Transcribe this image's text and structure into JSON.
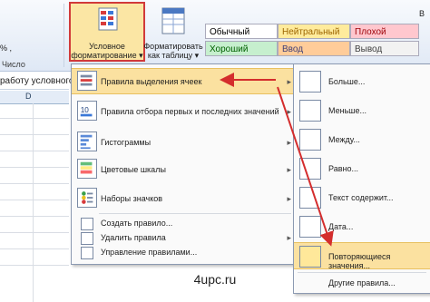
{
  "ribbon": {
    "left_partial": "%   ,",
    "group_label": "Число",
    "conditional_formatting": "Условное форматирование ▾",
    "format_as_table": "Форматировать как таблицу ▾",
    "right_partial": "В"
  },
  "cell_styles": [
    {
      "label": "Обычный",
      "bg": "#ffffff",
      "color": "#000000"
    },
    {
      "label": "Нейтральный",
      "bg": "#ffeb9c",
      "color": "#9c6500"
    },
    {
      "label": "Плохой",
      "bg": "#ffc7ce",
      "color": "#9c0006"
    },
    {
      "label": "Хороший",
      "bg": "#c6efce",
      "color": "#006100"
    },
    {
      "label": "Ввод",
      "bg": "#ffcc99",
      "color": "#3f3f76"
    },
    {
      "label": "Вывод",
      "bg": "#f2f2f2",
      "color": "#3f3f3f"
    }
  ],
  "formula_text": "работу условного",
  "column_header": "D",
  "menu": {
    "highlight_rules": "Правила выделения ячеек",
    "top_bottom": "Правила отбора первых и последних значений",
    "data_bars": "Гистограммы",
    "color_scales": "Цветовые шкалы",
    "icon_sets": "Наборы значков",
    "new_rule": "Создать правило...",
    "clear_rules": "Удалить правила",
    "manage_rules": "Управление правилами..."
  },
  "submenu": {
    "greater": "Больше...",
    "less": "Меньше...",
    "between": "Между...",
    "equal": "Равно...",
    "text_contains": "Текст содержит...",
    "date": "Дата...",
    "duplicates": "Повторяющиеся значения...",
    "other_rules": "Другие правила..."
  },
  "watermark": "4upc.ru",
  "colors": {
    "highlight": "#fbe1a0",
    "arrow": "#d42d2d",
    "border": "#d13a3a"
  }
}
